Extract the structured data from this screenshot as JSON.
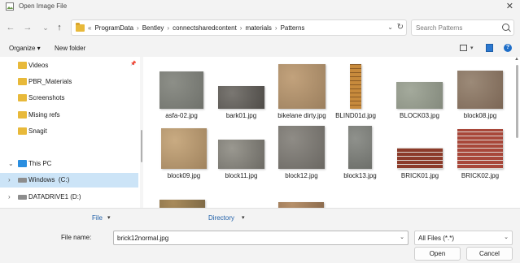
{
  "window": {
    "title": "Open Image File",
    "close_glyph": "✕",
    "icon": "image-file-icon"
  },
  "nav": {
    "back": "←",
    "forward": "→",
    "recent": "⌄",
    "up": "↑"
  },
  "address": {
    "overflow": "«",
    "crumbs": [
      "ProgramData",
      "Bentley",
      "connectsharedcontent",
      "materials",
      "Patterns"
    ],
    "separator": "›",
    "dropdown": "⌄",
    "refresh": "↻"
  },
  "search": {
    "placeholder": "Search Patterns"
  },
  "toolbar": {
    "organize": "Organize ▾",
    "new_folder": "New folder",
    "view_drop": "▾",
    "help": "?"
  },
  "sidebar": {
    "items": [
      {
        "label": "Videos",
        "icon": "folder-icon",
        "pinned": "📌"
      },
      {
        "label": "PBR_Materials",
        "icon": "folder-icon"
      },
      {
        "label": "Screenshots",
        "icon": "folder-icon"
      },
      {
        "label": "Mising refs",
        "icon": "folder-icon"
      },
      {
        "label": "Snagit",
        "icon": "folder-icon"
      },
      {
        "label": "This PC",
        "icon": "pc-icon",
        "chevron": "⌄"
      },
      {
        "label": "Windows  (C:)",
        "icon": "drive-icon",
        "chevron": "›",
        "selected": true
      },
      {
        "label": "DATADRIVE1 (D:)",
        "icon": "drive-icon",
        "chevron": "›"
      }
    ]
  },
  "files": [
    {
      "name": "asfa-02.jpg",
      "colors": [
        "#8d8f88",
        "#6f716b"
      ]
    },
    {
      "name": "bark01.jpg",
      "colors": [
        "#7a7772",
        "#4f4c48"
      ]
    },
    {
      "name": "bikelane dirty.jpg",
      "colors": [
        "#c2a27c",
        "#9b7f5e"
      ]
    },
    {
      "name": "BLIND01d.jpg",
      "colors": [
        "#c78a3c",
        "#8a5a24"
      ]
    },
    {
      "name": "BLOCK03.jpg",
      "colors": [
        "#a4aa9c",
        "#848a7d"
      ]
    },
    {
      "name": "block08.jpg",
      "colors": [
        "#9c8a78",
        "#7b6655"
      ]
    },
    {
      "name": "block09.jpg",
      "colors": [
        "#c9ab82",
        "#a0835e"
      ]
    },
    {
      "name": "block11.jpg",
      "colors": [
        "#9a9890",
        "#6c6a64"
      ]
    },
    {
      "name": "block12.jpg",
      "colors": [
        "#8f8c86",
        "#6a6762"
      ]
    },
    {
      "name": "block13.jpg",
      "colors": [
        "#8f918c",
        "#6d6f6a"
      ]
    },
    {
      "name": "BRICK01.jpg",
      "colors": [
        "#8c3b2a",
        "#dcd6d0"
      ]
    },
    {
      "name": "BRICK02.jpg",
      "colors": [
        "#a8473a",
        "#e0d8d2"
      ]
    },
    {
      "name": "",
      "colors": [
        "#a88a5a",
        "#7f6a46"
      ]
    },
    {
      "name": "",
      "colors": [
        "#b6906a",
        "#8d6c4e"
      ]
    }
  ],
  "bottom": {
    "col_file": "File",
    "col_directory": "Directory",
    "col_drop": "▾",
    "filename_label": "File name:",
    "filename_value": "brick12normal.jpg",
    "filter_value": "All Files (*.*)",
    "drop": "⌄",
    "open": "Open",
    "cancel": "Cancel"
  }
}
